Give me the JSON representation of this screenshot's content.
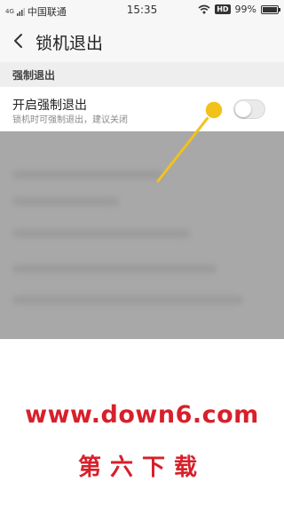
{
  "status_bar": {
    "signal": "4G",
    "carrier": "中国联通",
    "time": "15:35",
    "hd": "HD",
    "battery": "99%",
    "battery_level": 0.99
  },
  "header": {
    "back_icon": "chevron-left-icon",
    "title": "锁机退出"
  },
  "section": {
    "label": "强制退出"
  },
  "setting": {
    "title": "开启强制退出",
    "description": "锁机时可强制退出，建议关闭",
    "toggle_on": false
  },
  "annotation": {
    "color": "#f2c21b"
  },
  "watermark": {
    "url": "www.down6.com",
    "name": "第六下载",
    "color": "#d81f2a"
  }
}
